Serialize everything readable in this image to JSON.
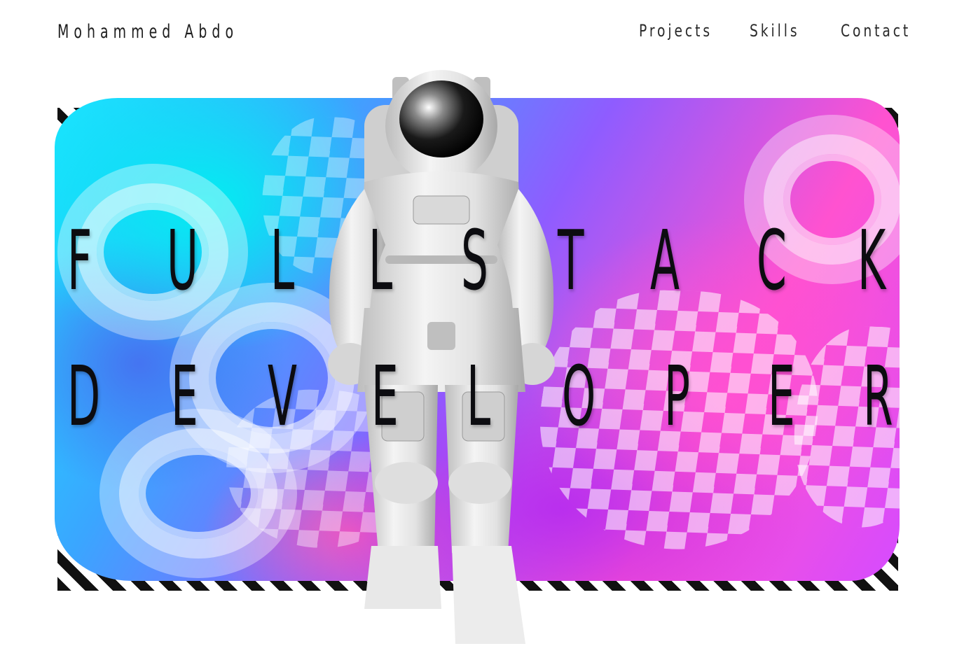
{
  "header": {
    "brand": "Mohammed Abdo",
    "nav": [
      {
        "label": "Projects"
      },
      {
        "label": "Skills"
      },
      {
        "label": "Contact"
      }
    ]
  },
  "hero": {
    "line1": [
      "F",
      "U",
      "L",
      "L",
      "S",
      "T",
      "A",
      "C",
      "K"
    ],
    "line2": [
      "D",
      "E",
      "V",
      "E",
      "L",
      "O",
      "P",
      "E",
      "R"
    ]
  },
  "colors": {
    "accent_cyan": "#19e6ff",
    "accent_magenta": "#ff52d0",
    "accent_purple": "#8f5cff",
    "text": "#0c0c10"
  }
}
